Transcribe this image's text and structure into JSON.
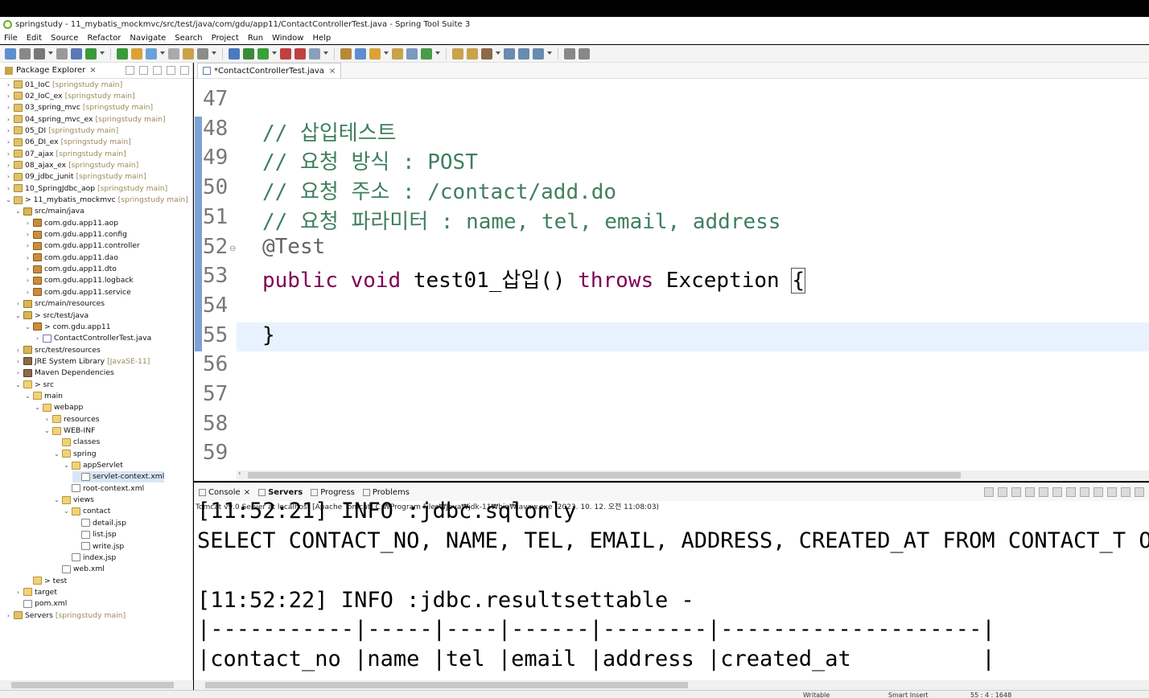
{
  "window": {
    "title": "springstudy - 11_mybatis_mockmvc/src/test/java/com/gdu/app11/ContactControllerTest.java - Spring Tool Suite 3"
  },
  "menu": [
    "File",
    "Edit",
    "Source",
    "Refactor",
    "Navigate",
    "Search",
    "Project",
    "Run",
    "Window",
    "Help"
  ],
  "explorer": {
    "tab_label": "Package Explorer",
    "close": "×",
    "items": [
      {
        "toggle": "›",
        "icon": "proj",
        "label": "01_IoC",
        "extra": "[springstudy main]"
      },
      {
        "toggle": "›",
        "icon": "proj",
        "label": "02_IoC_ex",
        "extra": "[springstudy main]"
      },
      {
        "toggle": "›",
        "icon": "proj",
        "label": "03_spring_mvc",
        "extra": "[springstudy main]"
      },
      {
        "toggle": "›",
        "icon": "proj",
        "label": "04_spring_mvc_ex",
        "extra": "[springstudy main]"
      },
      {
        "toggle": "›",
        "icon": "proj",
        "label": "05_DI",
        "extra": "[springstudy main]"
      },
      {
        "toggle": "›",
        "icon": "proj",
        "label": "06_DI_ex",
        "extra": "[springstudy main]"
      },
      {
        "toggle": "›",
        "icon": "proj",
        "label": "07_ajax",
        "extra": "[springstudy main]"
      },
      {
        "toggle": "›",
        "icon": "proj",
        "label": "08_ajax_ex",
        "extra": "[springstudy main]"
      },
      {
        "toggle": "›",
        "icon": "proj",
        "label": "09_jdbc_junit",
        "extra": "[springstudy main]"
      },
      {
        "toggle": "›",
        "icon": "proj",
        "label": "10_SpringJdbc_aop",
        "extra": "[springstudy main]"
      },
      {
        "toggle": "⌄",
        "icon": "proj",
        "label": "> 11_mybatis_mockmvc",
        "extra": "[springstudy main]"
      },
      {
        "toggle": "⌄",
        "icon": "srcf",
        "label": "src/main/java",
        "extra": ""
      },
      {
        "toggle": "›",
        "icon": "pkg",
        "label": "com.gdu.app11.aop",
        "extra": ""
      },
      {
        "toggle": "›",
        "icon": "pkg",
        "label": "com.gdu.app11.config",
        "extra": ""
      },
      {
        "toggle": "›",
        "icon": "pkg",
        "label": "com.gdu.app11.controller",
        "extra": ""
      },
      {
        "toggle": "›",
        "icon": "pkg",
        "label": "com.gdu.app11.dao",
        "extra": ""
      },
      {
        "toggle": "›",
        "icon": "pkg",
        "label": "com.gdu.app11.dto",
        "extra": ""
      },
      {
        "toggle": "›",
        "icon": "pkg",
        "label": "com.gdu.app11.logback",
        "extra": ""
      },
      {
        "toggle": "›",
        "icon": "pkg",
        "label": "com.gdu.app11.service",
        "extra": ""
      },
      {
        "toggle": "›",
        "icon": "srcf",
        "label": "src/main/resources",
        "extra": ""
      },
      {
        "toggle": "⌄",
        "icon": "srcf",
        "label": "> src/test/java",
        "extra": ""
      },
      {
        "toggle": "⌄",
        "icon": "pkg",
        "label": "> com.gdu.app11",
        "extra": ""
      },
      {
        "toggle": "›",
        "icon": "java",
        "label": "ContactControllerTest.java",
        "extra": ""
      },
      {
        "toggle": "›",
        "icon": "srcf",
        "label": "src/test/resources",
        "extra": ""
      },
      {
        "toggle": "›",
        "icon": "lib",
        "label": "JRE System Library",
        "extra": "[JavaSE-11]"
      },
      {
        "toggle": "›",
        "icon": "lib",
        "label": "Maven Dependencies",
        "extra": ""
      },
      {
        "toggle": "⌄",
        "icon": "folder",
        "label": "> src",
        "extra": ""
      },
      {
        "toggle": "⌄",
        "icon": "folder",
        "label": "main",
        "extra": ""
      },
      {
        "toggle": "⌄",
        "icon": "folder",
        "label": "webapp",
        "extra": ""
      },
      {
        "toggle": "›",
        "icon": "folder",
        "label": "resources",
        "extra": ""
      },
      {
        "toggle": "⌄",
        "icon": "folder",
        "label": "WEB-INF",
        "extra": ""
      },
      {
        "toggle": "",
        "icon": "folder",
        "label": "classes",
        "extra": ""
      },
      {
        "toggle": "⌄",
        "icon": "folder",
        "label": "spring",
        "extra": ""
      },
      {
        "toggle": "⌄",
        "icon": "folder",
        "label": "appServlet",
        "extra": ""
      },
      {
        "toggle": "",
        "icon": "file",
        "label": "servlet-context.xml",
        "extra": ""
      },
      {
        "toggle": "",
        "icon": "file",
        "label": "root-context.xml",
        "extra": ""
      },
      {
        "toggle": "⌄",
        "icon": "folder",
        "label": "views",
        "extra": ""
      },
      {
        "toggle": "⌄",
        "icon": "folder",
        "label": "contact",
        "extra": ""
      },
      {
        "toggle": "",
        "icon": "file",
        "label": "detail.jsp",
        "extra": ""
      },
      {
        "toggle": "",
        "icon": "file",
        "label": "list.jsp",
        "extra": ""
      },
      {
        "toggle": "",
        "icon": "file",
        "label": "write.jsp",
        "extra": ""
      },
      {
        "toggle": "",
        "icon": "file",
        "label": "index.jsp",
        "extra": ""
      },
      {
        "toggle": "",
        "icon": "file",
        "label": "web.xml",
        "extra": ""
      },
      {
        "toggle": "",
        "icon": "folder",
        "label": "> test",
        "extra": ""
      },
      {
        "toggle": "›",
        "icon": "folder",
        "label": "target",
        "extra": ""
      },
      {
        "toggle": "",
        "icon": "file",
        "label": "pom.xml",
        "extra": ""
      },
      {
        "toggle": "›",
        "icon": "proj",
        "label": "Servers",
        "extra": "[springstudy main]"
      }
    ]
  },
  "editor": {
    "tab_label": "*ContactControllerTest.java",
    "tab_close": "×",
    "lines": [
      {
        "num": "47",
        "segments": []
      },
      {
        "num": "48",
        "segments": [
          {
            "cls": "c-comment",
            "text": "// 삽입테스트"
          }
        ]
      },
      {
        "num": "49",
        "segments": [
          {
            "cls": "c-comment",
            "text": "// 요청 방식 : POST"
          }
        ]
      },
      {
        "num": "50",
        "segments": [
          {
            "cls": "c-comment",
            "text": "// 요청 주소 : /contact/add.do"
          }
        ]
      },
      {
        "num": "51",
        "segments": [
          {
            "cls": "c-comment",
            "text": "// 요청 파라미터 : name, tel, email, address"
          }
        ]
      },
      {
        "num": "52",
        "segments": [
          {
            "cls": "c-annot",
            "text": "@Test"
          }
        ]
      },
      {
        "num": "53",
        "segments": [
          {
            "cls": "c-kw",
            "text": "public void "
          },
          {
            "cls": "",
            "text": "test01_삽입() "
          },
          {
            "cls": "c-kw",
            "text": "throws "
          },
          {
            "cls": "",
            "text": "Exception "
          },
          {
            "cls": "brace-box",
            "text": "{"
          }
        ]
      },
      {
        "num": "54",
        "segments": []
      },
      {
        "num": "55",
        "segments": [
          {
            "cls": "",
            "text": "}"
          }
        ]
      },
      {
        "num": "56",
        "segments": []
      },
      {
        "num": "57",
        "segments": []
      },
      {
        "num": "58",
        "segments": []
      },
      {
        "num": "59",
        "segments": []
      }
    ]
  },
  "console": {
    "tabs": [
      {
        "label": "Console",
        "active": false,
        "close": "×"
      },
      {
        "label": "Servers",
        "active": true,
        "close": ""
      },
      {
        "label": "Progress",
        "active": false,
        "close": ""
      },
      {
        "label": "Problems",
        "active": false,
        "close": ""
      }
    ],
    "status": "Tomcat v9.0 Server at localhost [Apache Tomcat] C:₩Program Files₩Java₩jdk-11₩bin₩javaw.exe  (2023. 10. 12. 오전 11:08:03)",
    "lines": [
      "[11:52:21] INFO :jdbc.sqlonly",
      "SELECT CONTACT_NO, NAME, TEL, EMAIL, ADDRESS, CREATED_AT FROM CONTACT_T ORD",
      "",
      "[11:52:22] INFO :jdbc.resultsettable -",
      "|-----------|-----|----|------|--------|--------------------|",
      "|contact_no |name |tel |email |address |created_at          |"
    ]
  },
  "statusbar": {
    "writable": "Writable",
    "insert": "Smart Insert",
    "position": "55 : 4 : 1648"
  },
  "colors": {
    "comment": "#3f7f5f",
    "keyword": "#7f0055",
    "annotation": "#646464",
    "line_number": "#787878",
    "current_line": "#e8f2fe"
  }
}
